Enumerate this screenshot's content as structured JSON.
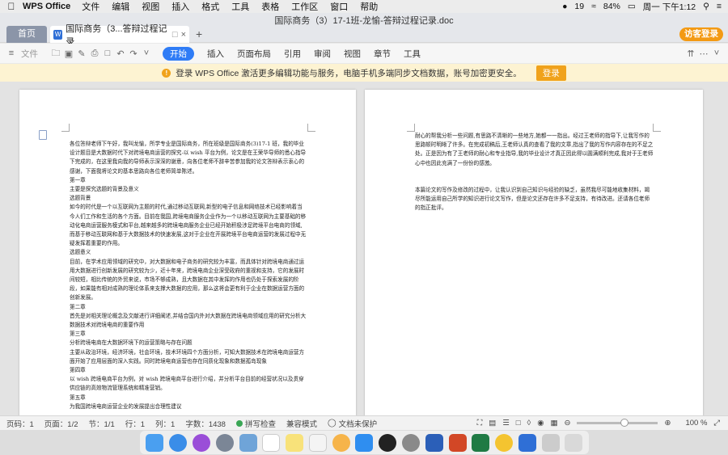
{
  "menubar": {
    "app_name": "WPS Office",
    "items": [
      "文件",
      "编辑",
      "视图",
      "插入",
      "格式",
      "工具",
      "表格",
      "工作区",
      "窗口",
      "帮助"
    ],
    "qq_badge": "19",
    "battery": "84%",
    "clock": "周一 下午1:12"
  },
  "window": {
    "title": "国际商务（3）17-1班-龙愉-答辩过程记录.doc",
    "home_tab": "首页",
    "doc_tab": "国际商务（3...答辩过程记录",
    "visitor_button": "访客登录"
  },
  "toolbar": {
    "file_menu": "文件",
    "tabs": [
      "开始",
      "插入",
      "页面布局",
      "引用",
      "审阅",
      "视图",
      "章节",
      "工具"
    ]
  },
  "notice": {
    "text": "登录 WPS Office 激活更多编辑功能与服务，电脑手机多端同步文档数据，账号加密更安全。",
    "button": "登录"
  },
  "page1": {
    "paragraphs": [
      "各位答辩老师下午好，我叫龙愉，所学专业是国际商务，所在班级是国际商务(3)17-1 班，我的毕业设计题目是大数据时代下对跨境电商运营的探究-以 wish 平台为例，论文是在王荣华导师的悉心指导下完成的，在这里我向我的导师表示深深的谢意，向各位老师不辞辛苦参加我的论文答辩表示衷心的感谢，下面我将论文的基本思路向各位老师简单陈述。",
      "第一章",
      "主要是探究选题的背景及意义",
      "选题背景",
      "如今的时代是一个以互联网为主题的时代,通过移动互联网,新型的电子信息和网络技术已经影响着当今人们工作和生活的各个方面。目前在我国,跨境电商服务企业作为一个以移动互联网为主要基础的移动化电商运营服务模式和平台,越来越多的跨境电商服务企业已经开始积极涉足跨境平台电商的领域,而基于移动互联网和基于大数据技术的快速发展,这对于企业在开展跨境平台电商运营的发展过程中无疑发挥着重要的作用。",
      "选题意义",
      "目前，在学术应用领域的研究中，对大数据和电子商务的研究较为丰富，而具体针对跨境电商通过运用大数据进行创新发展的研究较为少，近十年来，跨境电商企业深受政府的重视和支持，它的发展时间较短，相比传统的外贸来说，市场不够成熟，且大数据在其中发挥的作用也仍处于探索发展的阶段，如果能有相对成熟的理论体系来支撑大数据的应用，那么这将会更有利于企业在数据运营方面的创新发展。",
      "第二章",
      "首先是对相关理论概念及文献进行详细阐述,并结合国内外对大数据在跨境电商领域应用的研究分析大数据技术对跨境电商的重要作用",
      "第三章",
      "分析跨境电商在大数据环境下的运营策略与存在问题",
      "主要从政治环境，经济环境，社会环境，技术环境四个方面分析，可知大数据技术在跨境电商运营方面开始了应用层面的深入实践。同时跨境电商运营也存在同质化现象和数据孤岛现象",
      "第四章",
      "以 wish 跨境电商平台为例，对 wish 跨境电商平台进行介绍，并分析平台目前的经营状况以及贯穿供应链的高效物流管理系统和精准营销。",
      "第五章",
      "为我国跨境电商运营企业的发展提出合理性建议"
    ]
  },
  "page2": {
    "paragraphs": [
      "耐心的帮我分析一些问题,有思路不清晰的一些地方,她都一一指出。经过王老师的指导下,让我写作的思路顿时明晰了许多。在完成初稿后,王老师认真的查看了我的文章,指出了我的写作内容存在的不足之处。正是因为有了王老师的耐心和专业指导,我的毕业设计才真正因此得以圆满顺利完成,我对于王老师心中也因此充满了一份份的感激。",
      "",
      "本篇论文的写作及修改的过程中，让我认识到自己知识与经验的缺乏，虽然我尽可能地收集材料，竭尽所能运用自己所学的知识进行论文写作，但是论文还存在许多不足支持，有待改进。还请各位老师的指正批评。"
    ]
  },
  "statusbar": {
    "page_no": "页码：1",
    "pages": "页面：1/2",
    "section": "节：1/1",
    "row": "行：1",
    "col": "列：1",
    "words": "字数：1438",
    "spell": "拼写检查",
    "compat": "兼容模式",
    "protect": "文档未保护",
    "zoom": "100 %",
    "zoom_level": 0.6
  }
}
